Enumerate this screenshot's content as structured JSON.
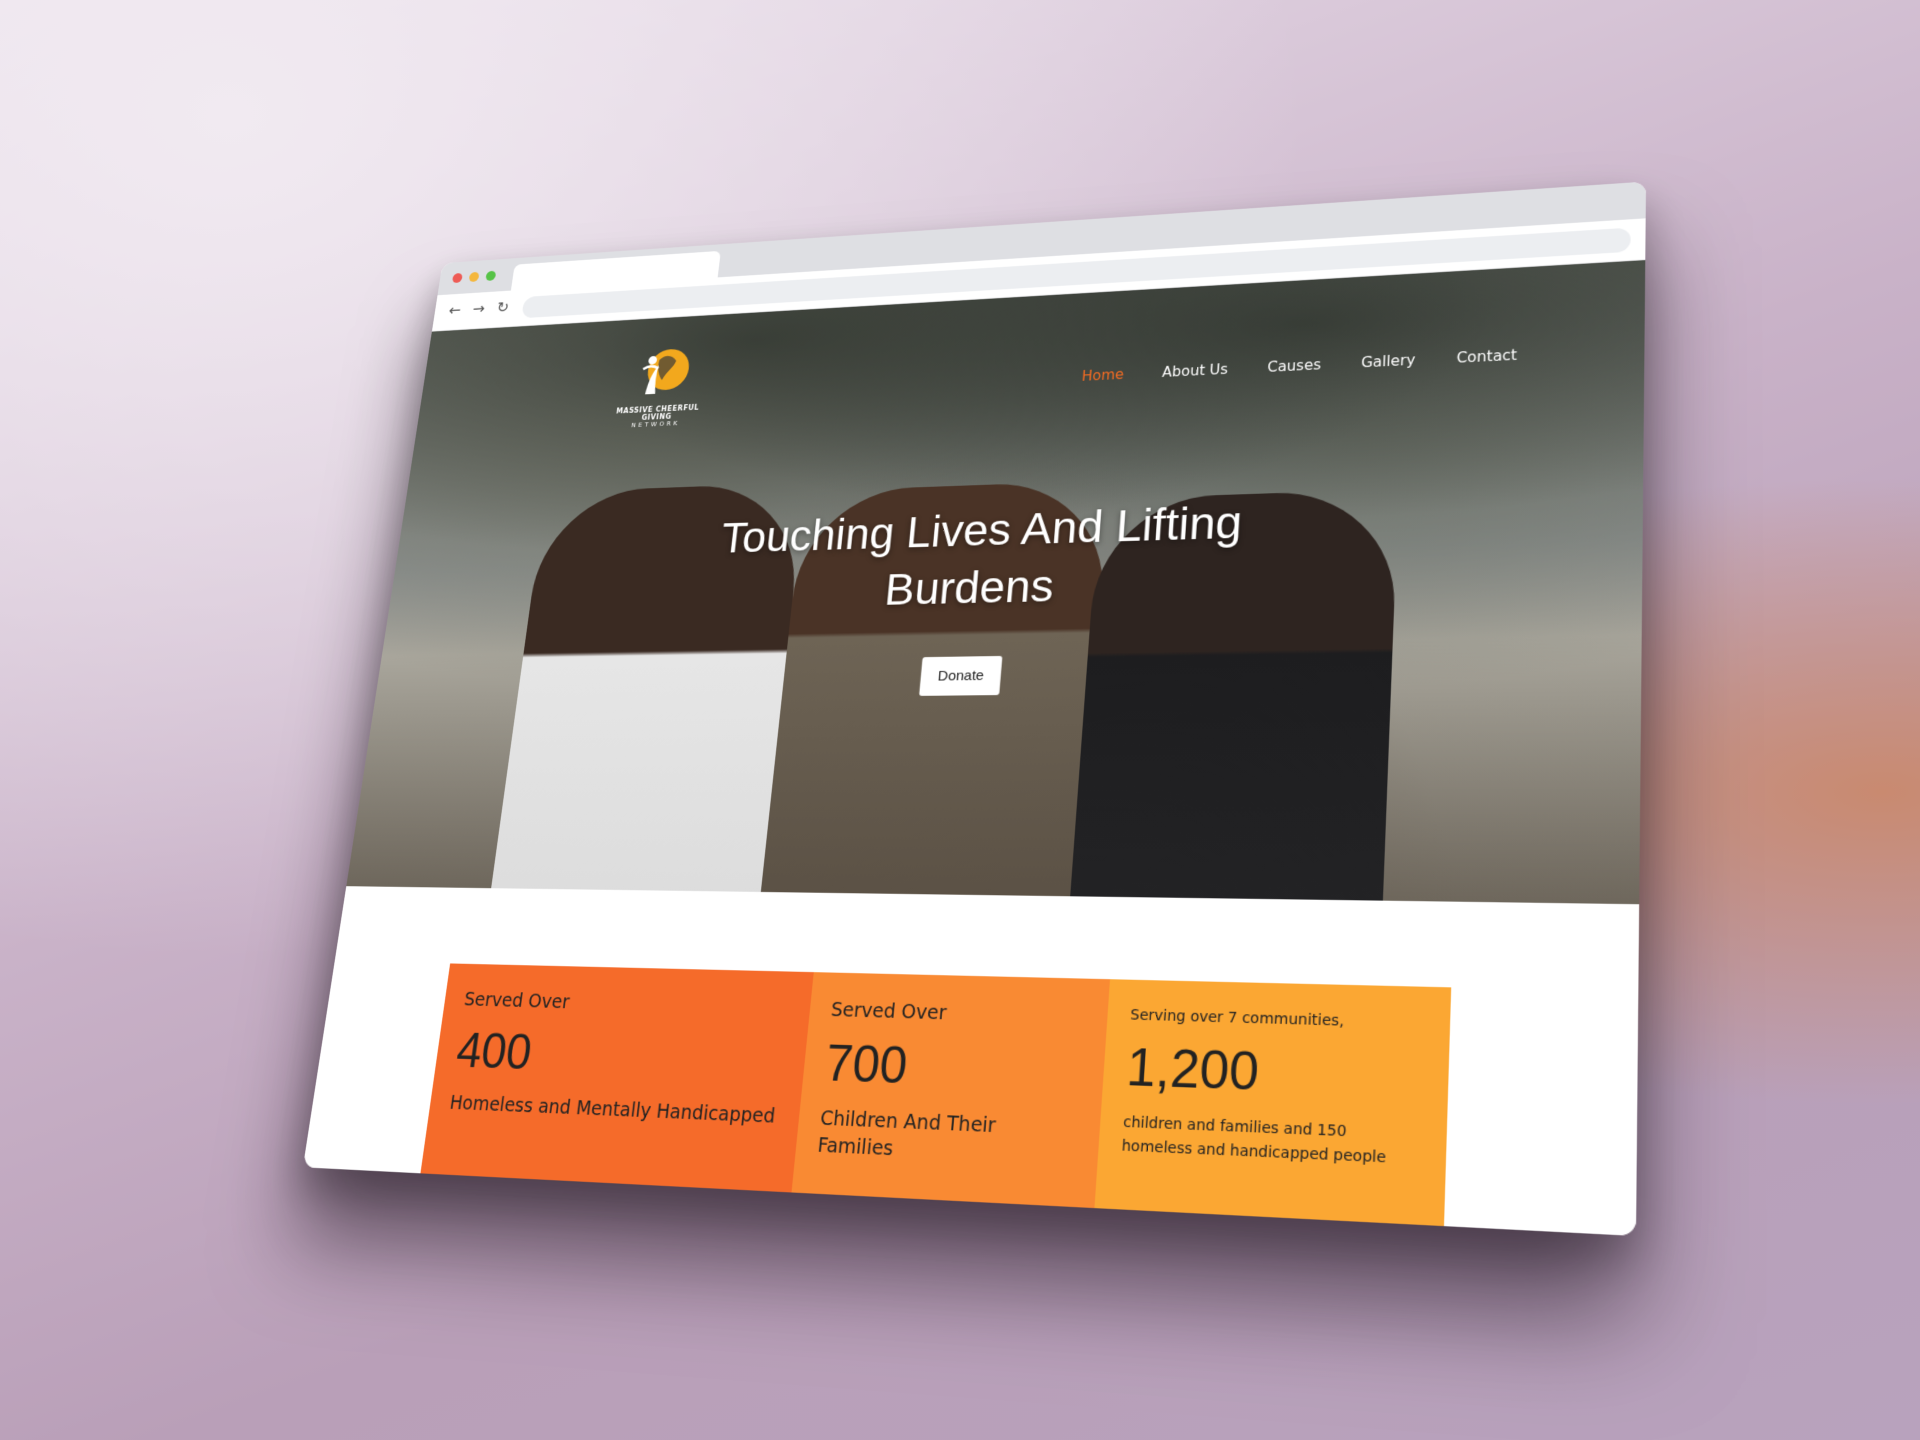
{
  "browser": {
    "back_icon": "←",
    "forward_icon": "→",
    "reload_icon": "↻"
  },
  "site": {
    "logo_name": "MASSIVE CHEERFUL GIVING",
    "logo_subname": "NETWORK",
    "nav": [
      {
        "label": "Home",
        "active": true
      },
      {
        "label": "About Us",
        "active": false
      },
      {
        "label": "Causes",
        "active": false
      },
      {
        "label": "Gallery",
        "active": false
      },
      {
        "label": "Contact",
        "active": false
      }
    ],
    "accent_color": "#f36b22"
  },
  "hero": {
    "headline_line1": "Touching Lives And Lifting",
    "headline_line2": "Burdens",
    "donate_label": "Donate"
  },
  "stats": [
    {
      "lead": "Served Over",
      "value": "400",
      "description": "Homeless and Mentally Handicapped",
      "color": "#f56b2a"
    },
    {
      "lead": "Served Over",
      "value": "700",
      "description": "Children And Their Families",
      "color": "#f98a33"
    },
    {
      "lead": "Serving over 7 communities,",
      "value": "1,200",
      "description": "children and families and 150 homeless and handicapped people",
      "color": "#fba733"
    }
  ]
}
